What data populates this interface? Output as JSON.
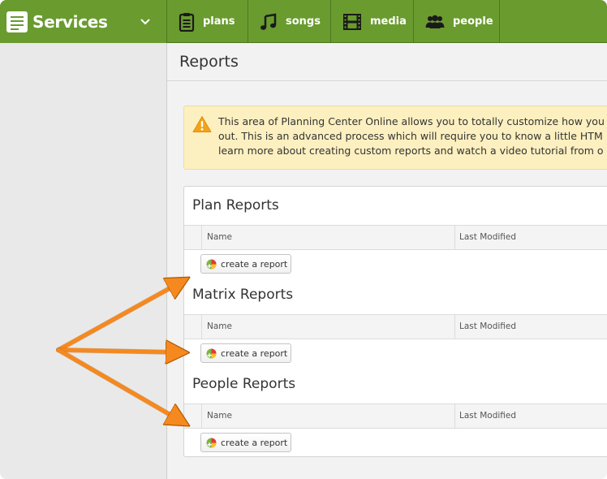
{
  "header": {
    "app_title": "Services",
    "tabs": [
      {
        "label": "plans",
        "icon": "clipboard-icon"
      },
      {
        "label": "songs",
        "icon": "music-note-icon"
      },
      {
        "label": "media",
        "icon": "film-icon"
      },
      {
        "label": "people",
        "icon": "people-icon"
      }
    ]
  },
  "main": {
    "title": "Reports",
    "notice": {
      "line1": "This area of Planning Center Online allows you to totally customize how you",
      "line2": "out. This is an advanced process which will require you to know a little HTM",
      "line3": "learn more about creating custom reports and watch a video tutorial from o"
    },
    "sections": [
      {
        "title": "Plan Reports",
        "col_name": "Name",
        "col_modified": "Last Modified",
        "button": "create a report"
      },
      {
        "title": "Matrix Reports",
        "col_name": "Name",
        "col_modified": "Last Modified",
        "button": "create a report"
      },
      {
        "title": "People Reports",
        "col_name": "Name",
        "col_modified": "Last Modified",
        "button": "create a report"
      }
    ]
  },
  "colors": {
    "brand_green": "#6a9b2f",
    "notice_bg": "#fdf0c0",
    "arrow_orange": "#f5891f"
  }
}
